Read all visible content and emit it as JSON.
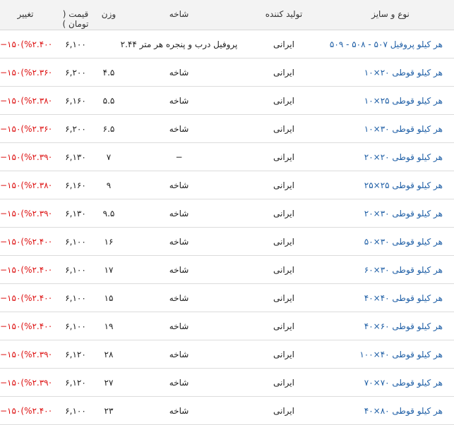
{
  "headers": {
    "name": "نوع و سایز",
    "producer": "تولید کننده",
    "brand": "شاخه",
    "weight": "وزن",
    "price": "قیمت ( تومان )",
    "change": "تغییر"
  },
  "rows": [
    {
      "name": "هر کیلو پروفیل ۵۰۷ - ۵۰۸ - ۵۰۹",
      "producer": "ایرانی",
      "brand": "پروفیل درب و پنجره هر متر ۲.۴۴",
      "weight": "",
      "price": "۶,۱۰۰",
      "pct": "(%۲.۴۰−)",
      "chg": "−۱۵۰"
    },
    {
      "name": "هر کیلو قوطی ۲۰×۱۰",
      "producer": "ایرانی",
      "brand": "شاخه",
      "weight": "۴.۵",
      "price": "۶,۲۰۰",
      "pct": "(%۲.۳۶−)",
      "chg": "−۱۵۰"
    },
    {
      "name": "هر کیلو قوطی ۲۵×۱۰",
      "producer": "ایرانی",
      "brand": "شاخه",
      "weight": "۵.۵",
      "price": "۶,۱۶۰",
      "pct": "(%۲.۳۸−)",
      "chg": "−۱۵۰"
    },
    {
      "name": "هر کیلو قوطی ۳۰×۱۰",
      "producer": "ایرانی",
      "brand": "شاخه",
      "weight": "۶.۵",
      "price": "۶,۲۰۰",
      "pct": "(%۲.۳۶−)",
      "chg": "−۱۵۰"
    },
    {
      "name": "هر کیلو قوطی ۲۰×۲۰",
      "producer": "ایرانی",
      "brand": "−",
      "weight": "۷",
      "price": "۶,۱۳۰",
      "pct": "(%۲.۳۹−)",
      "chg": "−۱۵۰"
    },
    {
      "name": "هر کیلو قوطی ۲۵×۲۵",
      "producer": "ایرانی",
      "brand": "شاخه",
      "weight": "۹",
      "price": "۶,۱۶۰",
      "pct": "(%۲.۳۸−)",
      "chg": "−۱۵۰"
    },
    {
      "name": "هر کیلو قوطی ۳۰×۲۰",
      "producer": "ایرانی",
      "brand": "شاخه",
      "weight": "۹.۵",
      "price": "۶,۱۳۰",
      "pct": "(%۲.۳۹−)",
      "chg": "−۱۵۰"
    },
    {
      "name": "هر کیلو قوطی ۳۰×۵۰",
      "producer": "ایرانی",
      "brand": "شاخه",
      "weight": "۱۶",
      "price": "۶,۱۰۰",
      "pct": "(%۲.۴۰−)",
      "chg": "−۱۵۰"
    },
    {
      "name": "هر کیلو قوطی ۳۰×۶۰",
      "producer": "ایرانی",
      "brand": "شاخه",
      "weight": "۱۷",
      "price": "۶,۱۰۰",
      "pct": "(%۲.۴۰−)",
      "chg": "−۱۵۰"
    },
    {
      "name": "هر کیلو قوطی ۴۰×۴۰",
      "producer": "ایرانی",
      "brand": "شاخه",
      "weight": "۱۵",
      "price": "۶,۱۰۰",
      "pct": "(%۲.۴۰−)",
      "chg": "−۱۵۰"
    },
    {
      "name": "هر کیلو قوطی ۶۰×۴۰",
      "producer": "ایرانی",
      "brand": "شاخه",
      "weight": "۱۹",
      "price": "۶,۱۰۰",
      "pct": "(%۲.۴۰−)",
      "chg": "−۱۵۰"
    },
    {
      "name": "هر کیلو قوطی ۴۰×۱۰۰",
      "producer": "ایرانی",
      "brand": "شاخه",
      "weight": "۲۸",
      "price": "۶,۱۲۰",
      "pct": "(%۲.۳۹−)",
      "chg": "−۱۵۰"
    },
    {
      "name": "هر کیلو قوطی ۷۰×۷۰",
      "producer": "ایرانی",
      "brand": "شاخه",
      "weight": "۲۷",
      "price": "۶,۱۲۰",
      "pct": "(%۲.۳۹−)",
      "chg": "−۱۵۰"
    },
    {
      "name": "هر کیلو قوطی ۸۰×۴۰",
      "producer": "ایرانی",
      "brand": "شاخه",
      "weight": "۲۳",
      "price": "۶,۱۰۰",
      "pct": "(%۲.۴۰−)",
      "chg": "−۱۵۰"
    }
  ]
}
